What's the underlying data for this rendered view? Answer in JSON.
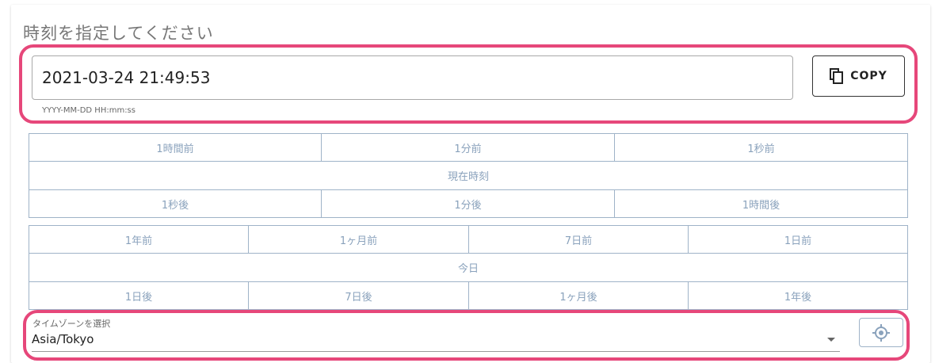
{
  "title": "時刻を指定してください",
  "datetime": {
    "value": "2021-03-24 21:49:53",
    "hint": "YYYY-MM-DD HH:mm:ss",
    "copy_label": "COPY"
  },
  "time_buttons": {
    "row1": [
      "1時間前",
      "1分前",
      "1秒前"
    ],
    "now": "現在時刻",
    "row3": [
      "1秒後",
      "1分後",
      "1時間後"
    ]
  },
  "date_buttons": {
    "row1": [
      "1年前",
      "1ヶ月前",
      "7日前",
      "1日前"
    ],
    "today": "今日",
    "row3": [
      "1日後",
      "7日後",
      "1ヶ月後",
      "1年後"
    ]
  },
  "timezone": {
    "label": "タイムゾーンを選択",
    "value": "Asia/Tokyo"
  },
  "colors": {
    "highlight": "#e6477a",
    "button_text": "#8aa2bc",
    "button_border": "#9fb3c8"
  }
}
